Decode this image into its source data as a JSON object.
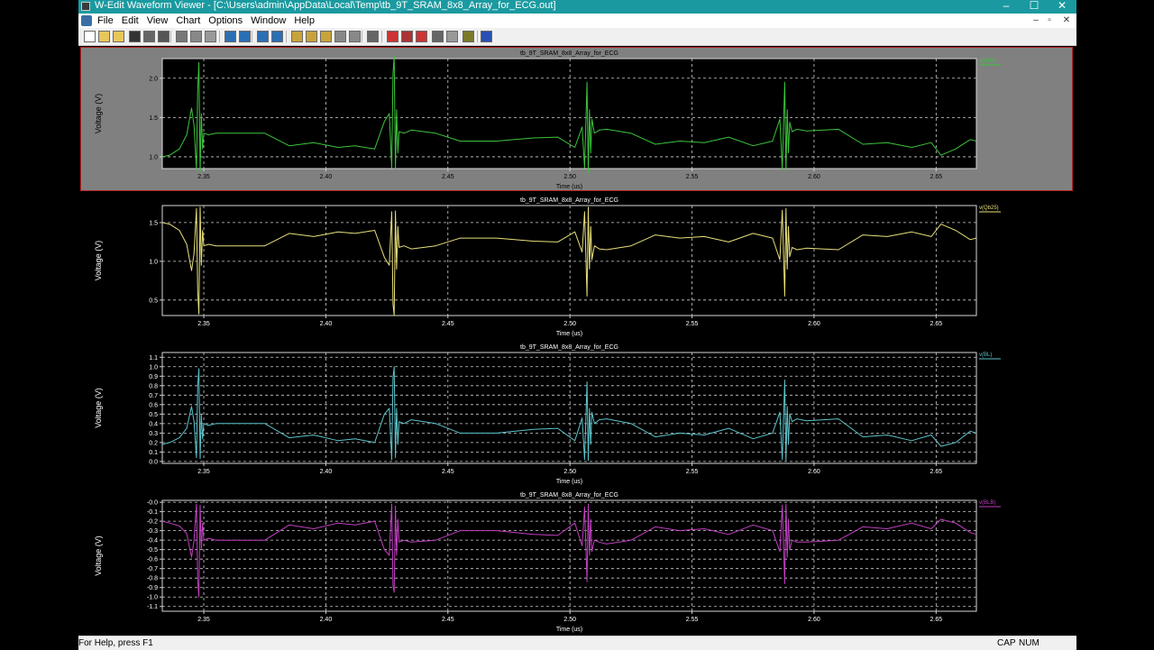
{
  "window": {
    "title": "W-Edit Waveform Viewer - [C:\\Users\\admin\\AppData\\Local\\Temp\\tb_9T_SRAM_8x8_Array_for_ECG.out]",
    "minimize": "–",
    "maximize": "☐",
    "close": "✕"
  },
  "menu": [
    "File",
    "Edit",
    "View",
    "Chart",
    "Options",
    "Window",
    "Help"
  ],
  "mdi_controls": [
    "–",
    "▫",
    "✕"
  ],
  "toolbar_icons": [
    "new-icon",
    "open-icon",
    "open-multiple-icon",
    "save-icon",
    "print-icon",
    "print-preview-icon",
    "cut-icon",
    "copy-icon",
    "paste-icon",
    "tile-icon",
    "cascade-icon",
    "home-icon",
    "zoom-fit-icon",
    "chart-add-icon",
    "chart-copy-icon",
    "chart-paste-icon",
    "chart-arrange-icon",
    "chart-stack-icon",
    "text-label-icon",
    "cursor-icon",
    "measure-icon",
    "marker-icon",
    "play-icon",
    "pause-icon",
    "settings-icon",
    "book-icon"
  ],
  "status": {
    "help": "For Help, press F1",
    "cap": "CAP",
    "num": "NUM"
  },
  "chart_data": [
    {
      "type": "line",
      "title": "tb_9T_SRAM_8x8_Array_for_ECG",
      "xlabel": "Time (us)",
      "ylabel": "Voltage (V)",
      "xlim": [
        2.333,
        2.6665
      ],
      "ylim": [
        0.85,
        2.25
      ],
      "xticks": [
        2.35,
        2.4,
        2.45,
        2.5,
        2.55,
        2.6,
        2.65
      ],
      "xtick_labels": [
        "2.35",
        "2.40",
        "2.45",
        "2.50",
        "2.55",
        "2.60",
        "2.65"
      ],
      "yticks": [
        1.0,
        1.5,
        2.0
      ],
      "ytick_labels": [
        "1.0",
        "1.5",
        "2.0"
      ],
      "grid": true,
      "legend": "top-right",
      "background": "black",
      "series": [
        {
          "name": "v(Q00)",
          "color": "#3cc43c",
          "x": [
            2.333,
            2.336,
            2.34,
            2.343,
            2.345,
            2.346,
            2.347,
            2.3475,
            2.348,
            2.3485,
            2.349,
            2.3495,
            2.35,
            2.352,
            2.355,
            2.365,
            2.375,
            2.385,
            2.395,
            2.405,
            2.412,
            2.42,
            2.424,
            2.426,
            2.427,
            2.4275,
            2.428,
            2.4285,
            2.429,
            2.4295,
            2.43,
            2.432,
            2.435,
            2.445,
            2.455,
            2.47,
            2.485,
            2.495,
            2.502,
            2.505,
            2.506,
            2.507,
            2.5075,
            2.508,
            2.5085,
            2.509,
            2.51,
            2.512,
            2.515,
            2.525,
            2.535,
            2.545,
            2.555,
            2.565,
            2.575,
            2.583,
            2.586,
            2.587,
            2.588,
            2.5885,
            2.589,
            2.5895,
            2.59,
            2.591,
            2.593,
            2.597,
            2.61,
            2.62,
            2.63,
            2.64,
            2.648,
            2.652,
            2.658,
            2.664,
            2.6665
          ],
          "y": [
            1.0,
            1.02,
            1.1,
            1.28,
            1.62,
            1.4,
            0.84,
            1.85,
            2.2,
            0.8,
            1.55,
            1.1,
            1.3,
            1.28,
            1.3,
            1.3,
            1.3,
            1.14,
            1.18,
            1.12,
            1.14,
            1.1,
            1.45,
            1.55,
            0.86,
            2.05,
            2.28,
            0.85,
            1.6,
            1.05,
            1.32,
            1.3,
            1.34,
            1.3,
            1.2,
            1.2,
            1.24,
            1.25,
            1.12,
            1.38,
            0.86,
            1.95,
            0.8,
            1.6,
            1.05,
            1.48,
            1.3,
            1.34,
            1.35,
            1.3,
            1.16,
            1.2,
            1.18,
            1.25,
            1.14,
            1.2,
            1.48,
            0.84,
            1.95,
            0.82,
            1.6,
            1.05,
            1.44,
            1.32,
            1.35,
            1.33,
            1.35,
            1.16,
            1.18,
            1.12,
            1.18,
            1.02,
            1.1,
            1.22,
            1.2
          ]
        }
      ]
    },
    {
      "type": "line",
      "title": "tb_9T_SRAM_8x8_Array_for_ECG",
      "xlabel": "Time (us)",
      "ylabel": "Voltage (V)",
      "xlim": [
        2.333,
        2.6665
      ],
      "ylim": [
        0.3,
        1.72
      ],
      "xticks": [
        2.35,
        2.4,
        2.45,
        2.5,
        2.55,
        2.6,
        2.65
      ],
      "xtick_labels": [
        "2.35",
        "2.40",
        "2.45",
        "2.50",
        "2.55",
        "2.60",
        "2.65"
      ],
      "yticks": [
        0.5,
        1.0,
        1.5
      ],
      "ytick_labels": [
        "0.5",
        "1.0",
        "1.5"
      ],
      "grid": true,
      "legend": "top-right",
      "background": "black",
      "series": [
        {
          "name": "v(Qb25)",
          "color": "#e8e07a",
          "x": [
            2.333,
            2.336,
            2.34,
            2.343,
            2.345,
            2.346,
            2.347,
            2.3475,
            2.348,
            2.3485,
            2.349,
            2.3495,
            2.35,
            2.352,
            2.355,
            2.365,
            2.375,
            2.385,
            2.395,
            2.405,
            2.412,
            2.42,
            2.424,
            2.426,
            2.427,
            2.4275,
            2.428,
            2.4285,
            2.429,
            2.4295,
            2.43,
            2.432,
            2.435,
            2.445,
            2.455,
            2.47,
            2.485,
            2.495,
            2.502,
            2.505,
            2.506,
            2.507,
            2.5075,
            2.508,
            2.5085,
            2.509,
            2.51,
            2.512,
            2.515,
            2.525,
            2.535,
            2.545,
            2.555,
            2.565,
            2.575,
            2.583,
            2.586,
            2.587,
            2.588,
            2.5885,
            2.589,
            2.5895,
            2.59,
            2.591,
            2.593,
            2.597,
            2.61,
            2.62,
            2.63,
            2.64,
            2.648,
            2.652,
            2.658,
            2.664,
            2.6665
          ],
          "y": [
            1.5,
            1.48,
            1.4,
            1.22,
            0.88,
            1.1,
            1.68,
            0.62,
            0.32,
            1.7,
            0.95,
            1.4,
            1.2,
            1.22,
            1.2,
            1.2,
            1.2,
            1.36,
            1.32,
            1.38,
            1.36,
            1.4,
            1.05,
            0.95,
            1.64,
            0.45,
            0.3,
            1.65,
            0.9,
            1.45,
            1.18,
            1.2,
            1.16,
            1.2,
            1.3,
            1.3,
            1.26,
            1.25,
            1.38,
            1.12,
            1.64,
            0.55,
            1.7,
            0.9,
            1.45,
            1.02,
            1.2,
            1.16,
            1.15,
            1.2,
            1.34,
            1.3,
            1.32,
            1.25,
            1.36,
            1.3,
            1.02,
            1.66,
            0.55,
            1.68,
            0.9,
            1.45,
            1.06,
            1.18,
            1.15,
            1.17,
            1.15,
            1.34,
            1.32,
            1.38,
            1.32,
            1.48,
            1.4,
            1.28,
            1.3
          ]
        }
      ]
    },
    {
      "type": "line",
      "title": "tb_9T_SRAM_8x8_Array_for_ECG",
      "xlabel": "Time (us)",
      "ylabel": "Voltage (V)",
      "xlim": [
        2.333,
        2.6665
      ],
      "ylim": [
        -0.02,
        1.15
      ],
      "xticks": [
        2.35,
        2.4,
        2.45,
        2.5,
        2.55,
        2.6,
        2.65
      ],
      "xtick_labels": [
        "2.35",
        "2.40",
        "2.45",
        "2.50",
        "2.55",
        "2.60",
        "2.65"
      ],
      "yticks": [
        0.0,
        0.1,
        0.2,
        0.3,
        0.4,
        0.5,
        0.6,
        0.7,
        0.8,
        0.9,
        1.0,
        1.1
      ],
      "ytick_labels": [
        "0.0",
        "0.1",
        "0.2",
        "0.3",
        "0.4",
        "0.5",
        "0.6",
        "0.7",
        "0.8",
        "0.9",
        "1.0",
        "1.1"
      ],
      "grid": true,
      "legend": "top-right",
      "background": "black",
      "series": [
        {
          "name": "v(BL)",
          "color": "#5cc4cc",
          "x": [
            2.333,
            2.336,
            2.34,
            2.343,
            2.345,
            2.346,
            2.347,
            2.3475,
            2.348,
            2.3485,
            2.349,
            2.3495,
            2.35,
            2.352,
            2.355,
            2.365,
            2.375,
            2.385,
            2.395,
            2.405,
            2.412,
            2.42,
            2.424,
            2.426,
            2.427,
            2.4275,
            2.428,
            2.4285,
            2.429,
            2.4295,
            2.43,
            2.432,
            2.435,
            2.445,
            2.455,
            2.47,
            2.485,
            2.495,
            2.502,
            2.505,
            2.506,
            2.507,
            2.5075,
            2.508,
            2.5085,
            2.509,
            2.51,
            2.512,
            2.515,
            2.525,
            2.535,
            2.545,
            2.555,
            2.565,
            2.575,
            2.583,
            2.586,
            2.587,
            2.588,
            2.5885,
            2.589,
            2.5895,
            2.59,
            2.591,
            2.593,
            2.597,
            2.61,
            2.62,
            2.63,
            2.64,
            2.648,
            2.652,
            2.658,
            2.664,
            2.6665
          ],
          "y": [
            0.18,
            0.2,
            0.25,
            0.35,
            0.58,
            0.42,
            0.04,
            0.8,
            0.98,
            0.03,
            0.5,
            0.24,
            0.4,
            0.38,
            0.4,
            0.4,
            0.4,
            0.25,
            0.28,
            0.22,
            0.24,
            0.2,
            0.5,
            0.56,
            0.02,
            0.88,
            1.0,
            0.04,
            0.56,
            0.18,
            0.42,
            0.4,
            0.44,
            0.4,
            0.3,
            0.3,
            0.34,
            0.35,
            0.22,
            0.46,
            0.02,
            0.84,
            0.01,
            0.56,
            0.18,
            0.52,
            0.4,
            0.44,
            0.45,
            0.4,
            0.26,
            0.3,
            0.28,
            0.35,
            0.24,
            0.3,
            0.52,
            0.02,
            0.86,
            0.01,
            0.58,
            0.18,
            0.5,
            0.42,
            0.45,
            0.43,
            0.45,
            0.26,
            0.28,
            0.22,
            0.28,
            0.16,
            0.2,
            0.32,
            0.3
          ]
        }
      ]
    },
    {
      "type": "line",
      "title": "tb_9T_SRAM_8x8_Array_for_ECG",
      "xlabel": "Time (us)",
      "ylabel": "Voltage (V)",
      "xlim": [
        2.333,
        2.6665
      ],
      "ylim": [
        -1.15,
        0.02
      ],
      "xticks": [
        2.35,
        2.4,
        2.45,
        2.5,
        2.55,
        2.6,
        2.65
      ],
      "xtick_labels": [
        "2.35",
        "2.40",
        "2.45",
        "2.50",
        "2.55",
        "2.60",
        "2.65"
      ],
      "yticks": [
        0.0,
        -0.1,
        -0.2,
        -0.3,
        -0.4,
        -0.5,
        -0.6,
        -0.7,
        -0.8,
        -0.9,
        -1.0,
        -1.1
      ],
      "ytick_labels": [
        "-0.0",
        "-0.1",
        "-0.2",
        "-0.3",
        "-0.4",
        "-0.5",
        "-0.6",
        "-0.7",
        "-0.8",
        "-0.9",
        "-1.0",
        "-1.1"
      ],
      "grid": true,
      "legend": "top-right",
      "background": "black",
      "series": [
        {
          "name": "v(BLB)",
          "color": "#c040c0",
          "x": [
            2.333,
            2.336,
            2.34,
            2.343,
            2.345,
            2.346,
            2.347,
            2.3475,
            2.348,
            2.3485,
            2.349,
            2.3495,
            2.35,
            2.352,
            2.355,
            2.365,
            2.375,
            2.385,
            2.395,
            2.405,
            2.412,
            2.42,
            2.424,
            2.426,
            2.427,
            2.4275,
            2.428,
            2.4285,
            2.429,
            2.4295,
            2.43,
            2.432,
            2.435,
            2.445,
            2.455,
            2.47,
            2.485,
            2.495,
            2.502,
            2.505,
            2.506,
            2.507,
            2.5075,
            2.508,
            2.5085,
            2.509,
            2.51,
            2.512,
            2.515,
            2.525,
            2.535,
            2.545,
            2.555,
            2.565,
            2.575,
            2.583,
            2.586,
            2.587,
            2.588,
            2.5885,
            2.589,
            2.5895,
            2.59,
            2.591,
            2.593,
            2.597,
            2.61,
            2.62,
            2.63,
            2.64,
            2.648,
            2.652,
            2.658,
            2.664,
            2.6665
          ],
          "y": [
            -0.2,
            -0.22,
            -0.25,
            -0.33,
            -0.58,
            -0.4,
            -0.02,
            -0.82,
            -1.0,
            -0.03,
            -0.5,
            -0.22,
            -0.4,
            -0.38,
            -0.4,
            -0.4,
            -0.4,
            -0.24,
            -0.28,
            -0.22,
            -0.24,
            -0.2,
            -0.5,
            -0.56,
            -0.02,
            -0.88,
            -0.95,
            -0.04,
            -0.56,
            -0.18,
            -0.42,
            -0.4,
            -0.42,
            -0.4,
            -0.3,
            -0.3,
            -0.34,
            -0.35,
            -0.22,
            -0.46,
            -0.05,
            -0.84,
            -0.02,
            -0.56,
            -0.18,
            -0.52,
            -0.4,
            -0.42,
            -0.44,
            -0.4,
            -0.26,
            -0.3,
            -0.28,
            -0.34,
            -0.24,
            -0.3,
            -0.52,
            -0.03,
            -0.86,
            -0.02,
            -0.58,
            -0.18,
            -0.5,
            -0.4,
            -0.42,
            -0.42,
            -0.4,
            -0.26,
            -0.28,
            -0.22,
            -0.28,
            -0.18,
            -0.22,
            -0.32,
            -0.34
          ]
        }
      ]
    }
  ]
}
